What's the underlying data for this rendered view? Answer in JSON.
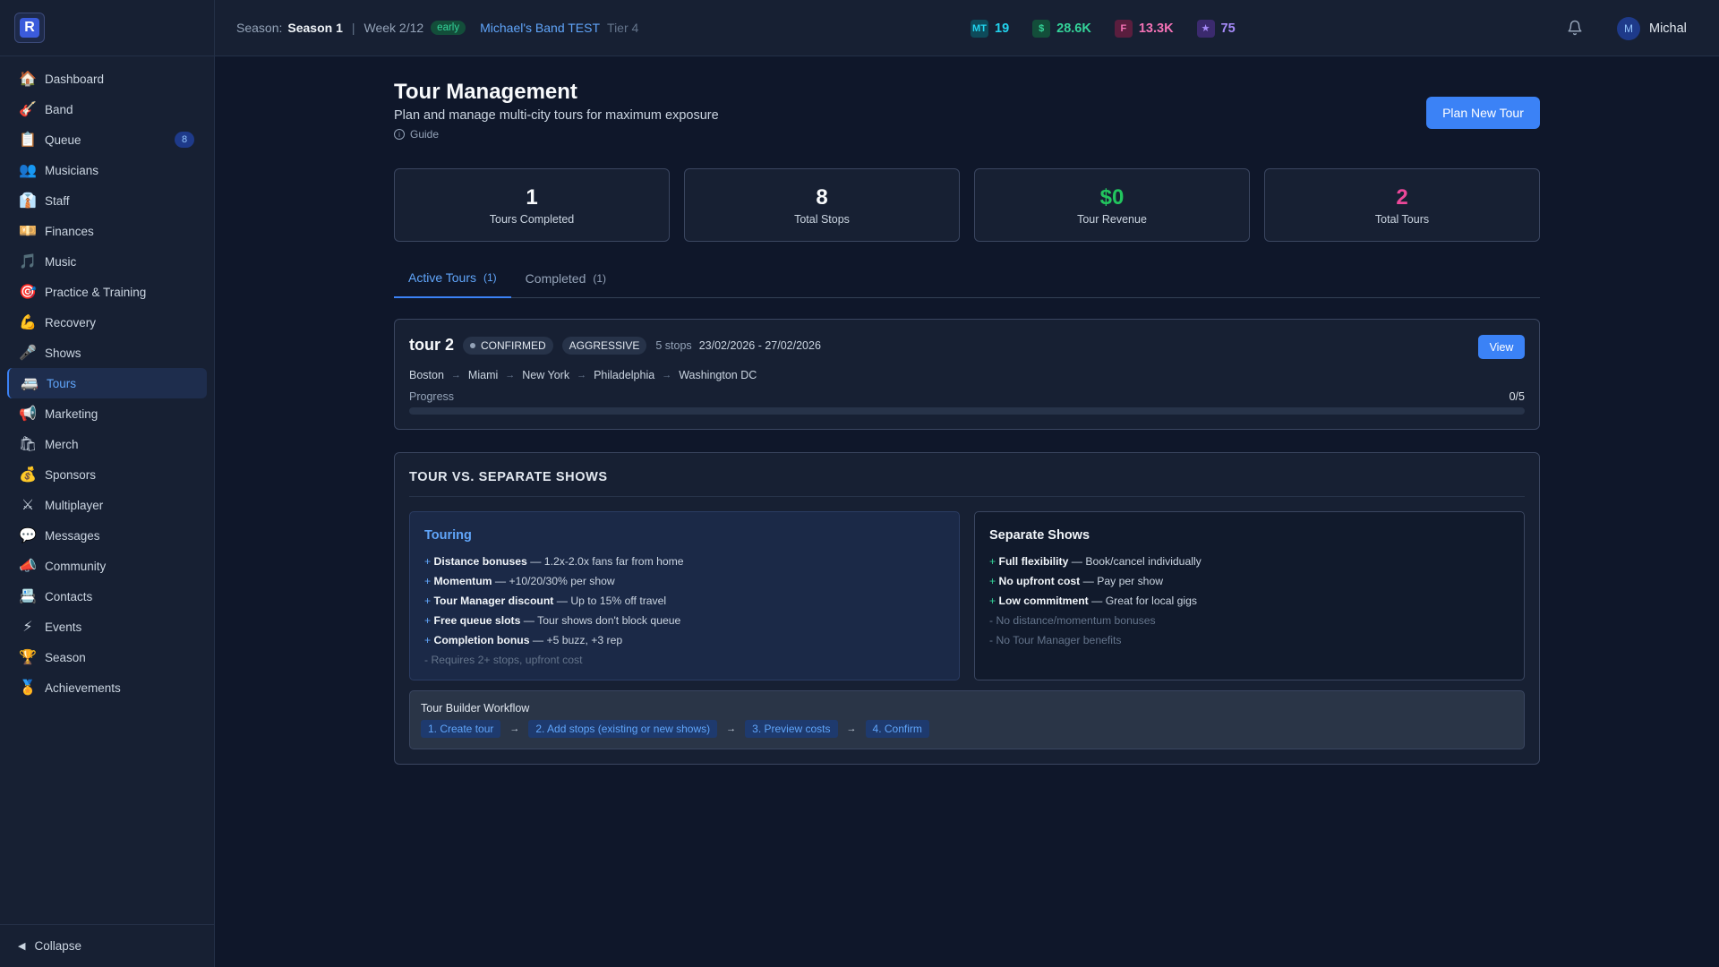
{
  "topbar": {
    "season_label": "Season:",
    "season_value": "Season 1",
    "separator": "|",
    "week": "Week 2/12",
    "phase": "early",
    "band_name": "Michael's Band TEST",
    "tier": "Tier 4",
    "stats": [
      {
        "icon": "MT",
        "value": "19",
        "icon_bg": "#0e4a5a",
        "icon_color": "#22d3ee",
        "color": "#22d3ee"
      },
      {
        "icon": "$",
        "value": "28.6K",
        "icon_bg": "#134e3a",
        "icon_color": "#34d399",
        "color": "#34d399"
      },
      {
        "icon": "F",
        "value": "13.3K",
        "icon_bg": "#5a1e3e",
        "icon_color": "#f472b6",
        "color": "#f472b6"
      },
      {
        "icon": "★",
        "value": "75",
        "icon_bg": "#3b2a6e",
        "icon_color": "#a78bfa",
        "color": "#a78bfa"
      }
    ],
    "user": {
      "initial": "M",
      "name": "Michal"
    }
  },
  "sidebar": {
    "logo": "R",
    "items": [
      {
        "icon": "🏠",
        "label": "Dashboard"
      },
      {
        "icon": "🎸",
        "label": "Band"
      },
      {
        "icon": "📋",
        "label": "Queue",
        "badge": "8"
      },
      {
        "icon": "👥",
        "label": "Musicians"
      },
      {
        "icon": "👔",
        "label": "Staff"
      },
      {
        "icon": "💴",
        "label": "Finances"
      },
      {
        "icon": "🎵",
        "label": "Music"
      },
      {
        "icon": "🎯",
        "label": "Practice & Training"
      },
      {
        "icon": "💪",
        "label": "Recovery"
      },
      {
        "icon": "🎤",
        "label": "Shows"
      },
      {
        "icon": "🚐",
        "label": "Tours",
        "active": true
      },
      {
        "icon": "📢",
        "label": "Marketing"
      },
      {
        "icon": "🛍",
        "label": "Merch"
      },
      {
        "icon": "💰",
        "label": "Sponsors"
      },
      {
        "icon": "⚔",
        "label": "Multiplayer"
      },
      {
        "icon": "💬",
        "label": "Messages"
      },
      {
        "icon": "📣",
        "label": "Community"
      },
      {
        "icon": "📇",
        "label": "Contacts"
      },
      {
        "icon": "⚡",
        "label": "Events"
      },
      {
        "icon": "🏆",
        "label": "Season"
      },
      {
        "icon": "🏅",
        "label": "Achievements"
      }
    ],
    "collapse_label": "Collapse"
  },
  "page": {
    "title": "Tour Management",
    "subtitle": "Plan and manage multi-city tours for maximum exposure",
    "guide": "Guide",
    "plan_button": "Plan New Tour"
  },
  "kpis": [
    {
      "value": "1",
      "label": "Tours Completed",
      "color": "#f8fafc"
    },
    {
      "value": "8",
      "label": "Total Stops",
      "color": "#f8fafc"
    },
    {
      "value": "$0",
      "label": "Tour Revenue",
      "color": "#22c55e"
    },
    {
      "value": "2",
      "label": "Total Tours",
      "color": "#ec4899"
    }
  ],
  "tabs": [
    {
      "label": "Active Tours",
      "count": "(1)",
      "active": true
    },
    {
      "label": "Completed",
      "count": "(1)"
    }
  ],
  "tour": {
    "name": "tour 2",
    "status": "CONFIRMED",
    "style": "AGGRESSIVE",
    "stops_count": "5 stops",
    "dates": "23/02/2026 - 27/02/2026",
    "view_button": "View",
    "route": [
      "Boston",
      "Miami",
      "New York",
      "Philadelphia",
      "Washington DC"
    ],
    "progress_label": "Progress",
    "progress_text": "0/5",
    "progress_fraction": 0
  },
  "compare": {
    "title": "TOUR VS. SEPARATE SHOWS",
    "touring": {
      "title": "Touring",
      "rows": [
        {
          "name": "Distance bonuses",
          "desc": "— 1.2x-2.0x fans far from home"
        },
        {
          "name": "Momentum",
          "desc": "— +10/20/30% per show"
        },
        {
          "name": "Tour Manager discount",
          "desc": "— Up to 15% off travel"
        },
        {
          "name": "Free queue slots",
          "desc": "— Tour shows don't block queue"
        },
        {
          "name": "Completion bonus",
          "desc": "— +5 buzz, +3 rep"
        }
      ],
      "note": "- Requires 2+ stops, upfront cost"
    },
    "separate": {
      "title": "Separate Shows",
      "rows": [
        {
          "name": "Full flexibility",
          "desc": "— Book/cancel individually"
        },
        {
          "name": "No upfront cost",
          "desc": "— Pay per show"
        },
        {
          "name": "Low commitment",
          "desc": "— Great for local gigs"
        }
      ],
      "notes": [
        "- No distance/momentum bonuses",
        "- No Tour Manager benefits"
      ]
    },
    "workflow": {
      "title": "Tour Builder Workflow",
      "steps": [
        "1. Create tour",
        "2. Add stops (existing or new shows)",
        "3. Preview costs",
        "4. Confirm"
      ]
    }
  }
}
